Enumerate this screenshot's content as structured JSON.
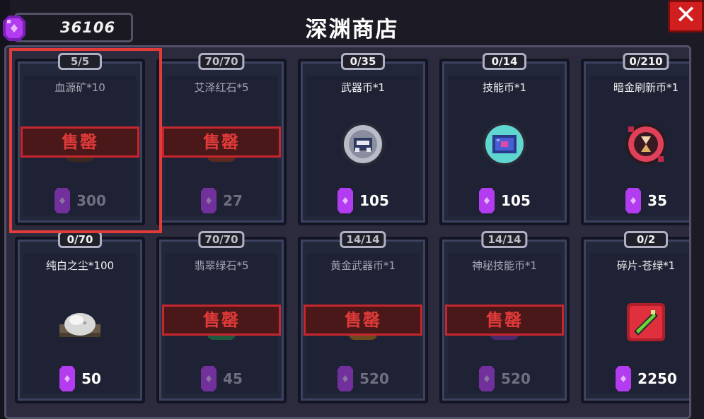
{
  "header": {
    "title": "深渊商店",
    "currency_value": "36106",
    "close_label": "✕"
  },
  "shop": {
    "sold_label": "售罄",
    "items": [
      {
        "stock": "5/5",
        "name": "血源矿*10",
        "price": "300",
        "sold_out": true,
        "selected": true
      },
      {
        "stock": "70/70",
        "name": "艾泽红石*5",
        "price": "27",
        "sold_out": true
      },
      {
        "stock": "0/35",
        "name": "武器币*1",
        "price": "105",
        "sold_out": false,
        "icon": "weapon-coin-icon"
      },
      {
        "stock": "0/14",
        "name": "技能币*1",
        "price": "105",
        "sold_out": false,
        "icon": "skill-coin-icon"
      },
      {
        "stock": "0/210",
        "name": "暗金刷新币*1",
        "price": "35",
        "sold_out": false,
        "icon": "refresh-coin-icon"
      },
      {
        "stock": "0/70",
        "name": "纯白之尘*100",
        "price": "50",
        "sold_out": false,
        "icon": "white-dust-icon"
      },
      {
        "stock": "70/70",
        "name": "翡翠绿石*5",
        "price": "45",
        "sold_out": true
      },
      {
        "stock": "14/14",
        "name": "黄金武器币*1",
        "price": "520",
        "sold_out": true
      },
      {
        "stock": "14/14",
        "name": "神秘技能币*1",
        "price": "520",
        "sold_out": true
      },
      {
        "stock": "0/2",
        "name": "碎片-苍绿*1",
        "price": "2250",
        "sold_out": false,
        "icon": "green-shard-icon"
      }
    ]
  },
  "colors": {
    "currency_purple": "#a32ee0",
    "sold_red": "#e03a3a",
    "close_red": "#d11f1f"
  }
}
